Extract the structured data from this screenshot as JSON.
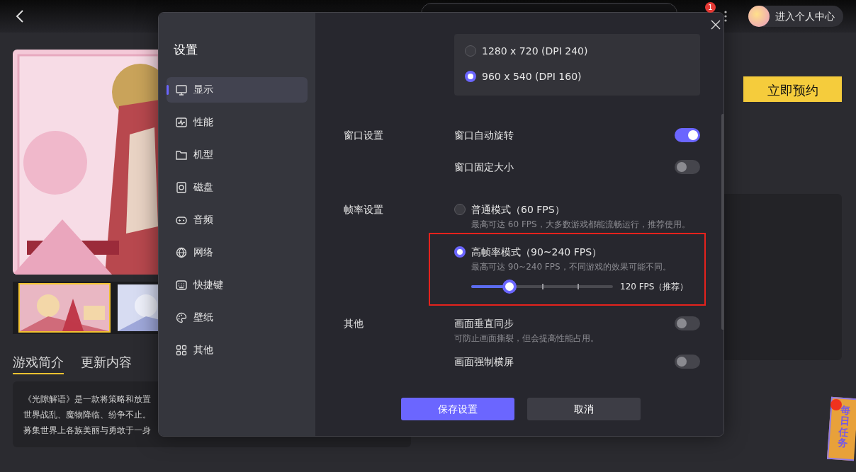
{
  "topbar": {
    "notification_count": "1",
    "user_label": "进入个人中心"
  },
  "reserve_button": "立即预约",
  "thumbnails": [
    {
      "selected": true
    },
    {
      "selected": false
    }
  ],
  "tabs": [
    {
      "label": "游戏简介",
      "selected": true
    },
    {
      "label": "更新内容",
      "selected": false
    }
  ],
  "description_lines": [
    "《光隙解语》是一款将策略和放置",
    "世界战乱、魔物降临、纷争不止。",
    "募集世界上各族美丽与勇敢于一身"
  ],
  "settings": {
    "title": "设置",
    "nav": [
      {
        "label": "显示",
        "selected": true
      },
      {
        "label": "性能",
        "selected": false
      },
      {
        "label": "机型",
        "selected": false
      },
      {
        "label": "磁盘",
        "selected": false
      },
      {
        "label": "音频",
        "selected": false
      },
      {
        "label": "网络",
        "selected": false
      },
      {
        "label": "快捷键",
        "selected": false
      },
      {
        "label": "壁纸",
        "selected": false
      },
      {
        "label": "其他",
        "selected": false
      }
    ],
    "resolutions": [
      {
        "label": "1280 x 720 (DPI 240)",
        "selected": false
      },
      {
        "label": "960 x 540 (DPI 160)",
        "selected": true
      }
    ],
    "sections": [
      {
        "label": "窗口设置",
        "items": [
          {
            "kind": "toggle",
            "label": "窗口自动旋转",
            "on": true
          },
          {
            "kind": "toggle",
            "label": "窗口固定大小",
            "on": false
          }
        ]
      },
      {
        "label": "帧率设置",
        "items": [
          {
            "kind": "radio",
            "label": "普通模式（60 FPS）",
            "hint": "最高可达 60 FPS，大多数游戏都能流畅运行，推荐使用。",
            "selected": false,
            "highlighted": false
          },
          {
            "kind": "radio",
            "label": "高帧率模式（90~240 FPS）",
            "hint": "最高可达 90~240 FPS，不同游戏的效果可能不同。",
            "selected": true,
            "highlighted": true,
            "slider": {
              "level": 0.27,
              "reading": "120 FPS（推荐）"
            }
          }
        ]
      },
      {
        "label": "其他",
        "items": [
          {
            "kind": "toggle",
            "label": "画面垂直同步",
            "hint": "可防止画面撕裂，但会提高性能占用。",
            "on": false
          },
          {
            "kind": "toggle",
            "label": "画面强制横屏",
            "on": false
          }
        ]
      }
    ],
    "buttons": [
      {
        "label": "保存设置",
        "kind": "primary"
      },
      {
        "label": "取消",
        "kind": "secondary"
      }
    ]
  },
  "daily_task": {
    "label": "每日任务"
  }
}
